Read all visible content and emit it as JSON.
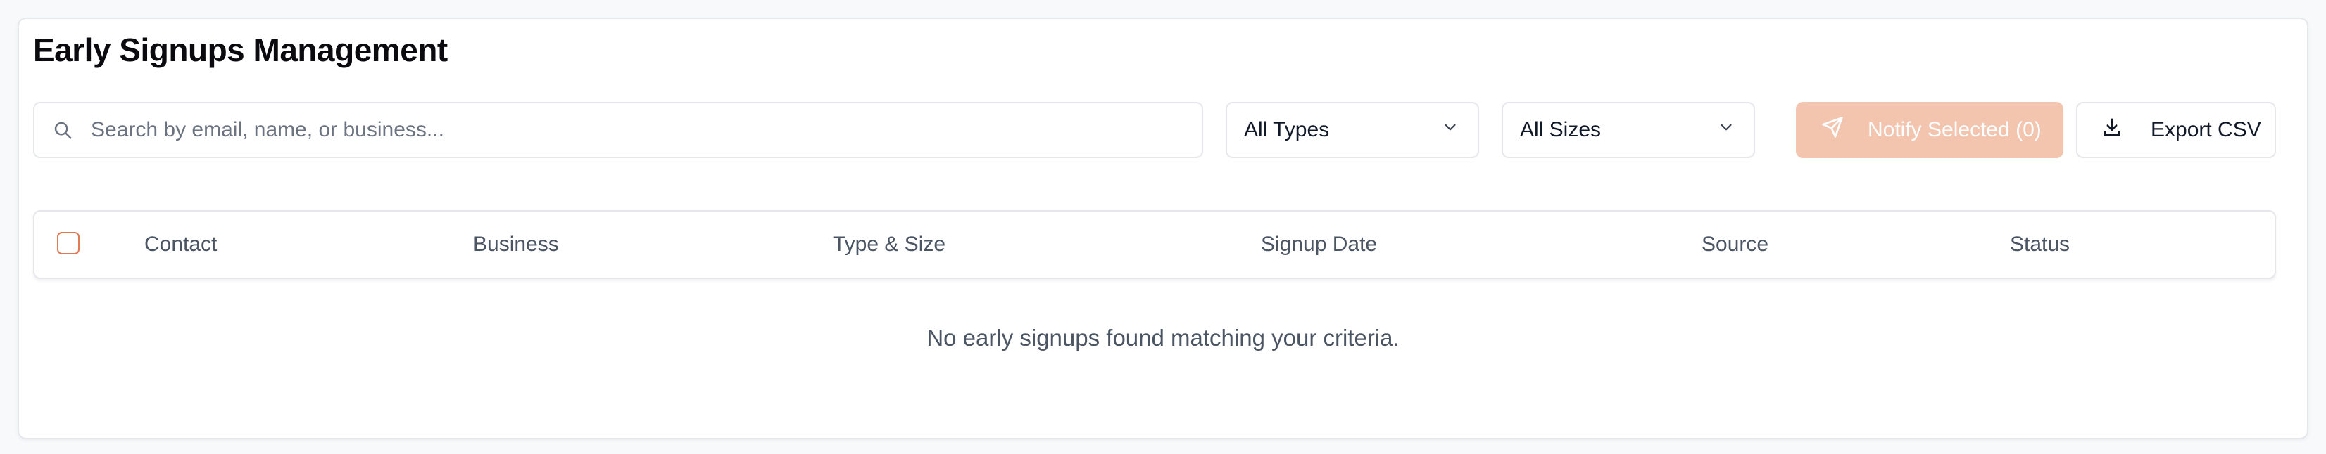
{
  "page": {
    "title": "Early Signups Management"
  },
  "toolbar": {
    "search_placeholder": "Search by email, name, or business...",
    "type_filter": {
      "selected": "All Types"
    },
    "size_filter": {
      "selected": "All Sizes"
    },
    "notify_label": "Notify Selected (0)",
    "export_label": "Export CSV"
  },
  "table": {
    "columns": [
      "Contact",
      "Business",
      "Type & Size",
      "Signup Date",
      "Source",
      "Status"
    ],
    "rows": [],
    "empty_message": "No early signups found matching your criteria."
  },
  "colors": {
    "accent_disabled": "#f3c4ae",
    "accent": "#e07a55",
    "border": "#e5e7eb",
    "text_muted": "#4b5563"
  },
  "icons": {
    "search": "search-icon",
    "chevron": "chevron-down-icon",
    "notify": "send-icon",
    "export": "download-icon"
  }
}
